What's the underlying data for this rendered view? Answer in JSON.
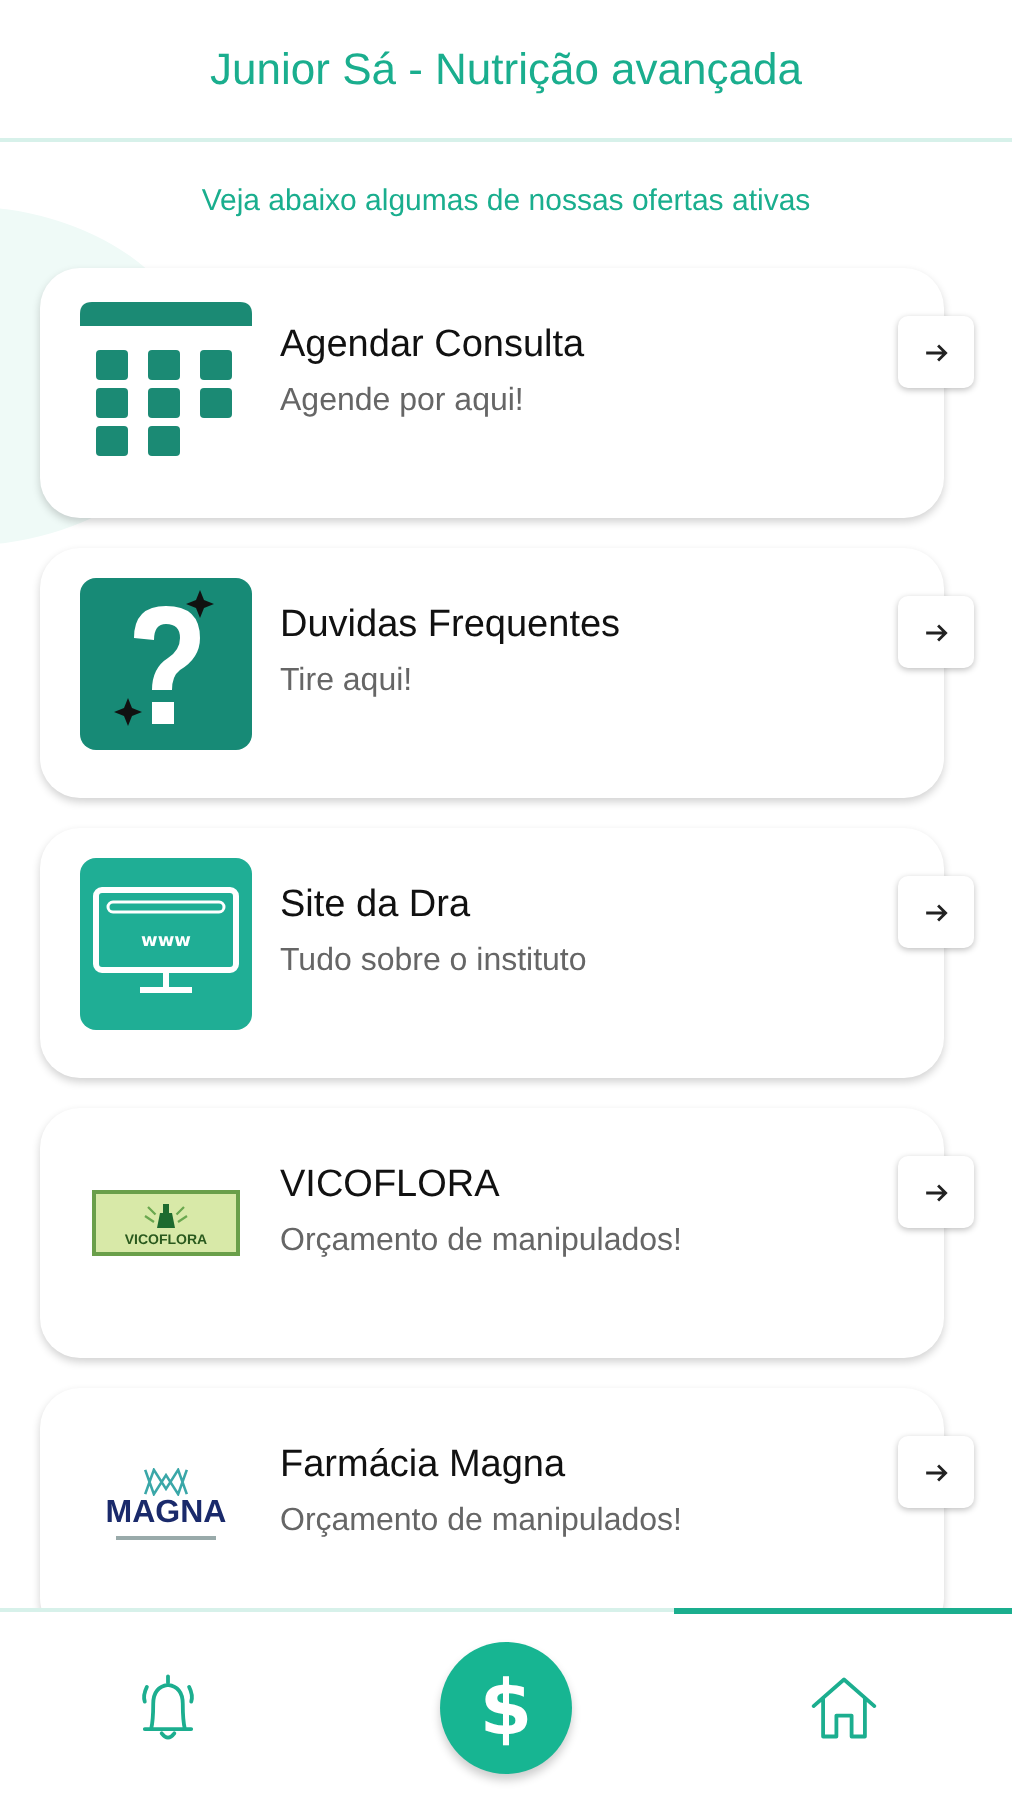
{
  "header": {
    "title": "Junior Sá - Nutrição avançada"
  },
  "subtitle": "Veja abaixo algumas de nossas ofertas ativas",
  "offers": [
    {
      "kind": "calendar",
      "title": "Agendar Consulta",
      "subtitle": "Agende por aqui!"
    },
    {
      "kind": "question",
      "title": "Duvidas Frequentes",
      "subtitle": "Tire aqui!"
    },
    {
      "kind": "monitor",
      "title": "Site da Dra",
      "subtitle": "Tudo sobre o instituto",
      "icon_text": "www"
    },
    {
      "kind": "vicoflora",
      "title": "VICOFLORA",
      "subtitle": "Orçamento de manipulados!",
      "logo_text": "VICOFLORA"
    },
    {
      "kind": "magna",
      "title": "Farmácia Magna",
      "subtitle": "Orçamento de manipulados!",
      "logo_text": "MAGNA"
    }
  ],
  "nav": [
    {
      "kind": "bell",
      "selected": false
    },
    {
      "kind": "dollar",
      "selected": false,
      "label": "$"
    },
    {
      "kind": "home",
      "selected": true
    }
  ]
}
